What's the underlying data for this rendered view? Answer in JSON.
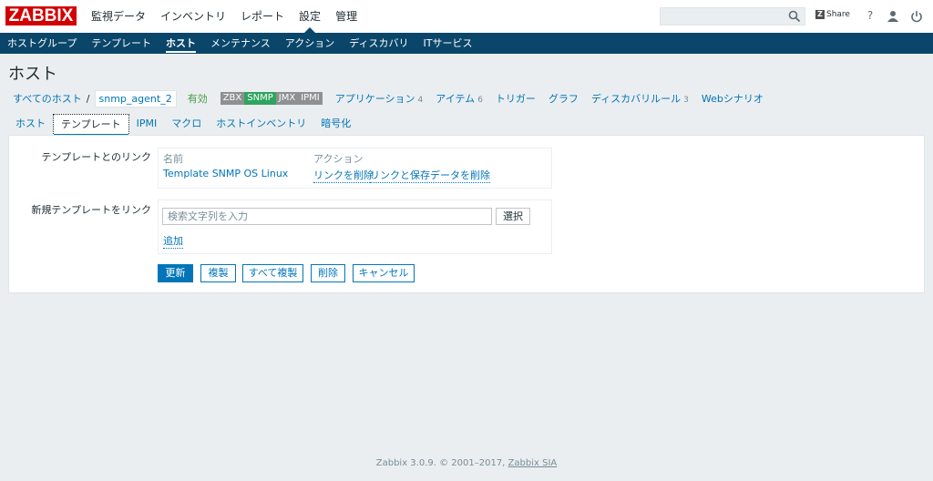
{
  "logo": "ZABBIX",
  "main_menu": [
    "監視データ",
    "インベントリ",
    "レポート",
    "設定",
    "管理"
  ],
  "header": {
    "share": "Share",
    "help": "?"
  },
  "sub_menu": [
    "ホストグループ",
    "テンプレート",
    "ホスト",
    "メンテナンス",
    "アクション",
    "ディスカバリ",
    "ITサービス"
  ],
  "page_title": "ホスト",
  "breadcrumb": {
    "all_hosts": "すべてのホスト",
    "separator": "/",
    "host": "snmp_agent_2",
    "status": "有効",
    "tags": [
      "ZBX",
      "SNMP",
      "JMX",
      "IPMI"
    ],
    "links": [
      {
        "label": "アプリケーション",
        "count": "4"
      },
      {
        "label": "アイテム",
        "count": "6"
      },
      {
        "label": "トリガー",
        "count": ""
      },
      {
        "label": "グラフ",
        "count": ""
      },
      {
        "label": "ディスカバリルール",
        "count": "3"
      },
      {
        "label": "Webシナリオ",
        "count": ""
      }
    ]
  },
  "tabs": [
    "ホスト",
    "テンプレート",
    "IPMI",
    "マクロ",
    "ホストインベントリ",
    "暗号化"
  ],
  "form": {
    "linked_label": "テンプレートとのリンク",
    "col_name": "名前",
    "col_action": "アクション",
    "template_name": "Template SNMP OS Linux",
    "unlink": "リンクを削除",
    "unlink_clear": "リンクと保存データを削除",
    "new_label": "新規テンプレートをリンク",
    "search_placeholder": "検索文字列を入力",
    "select_btn": "選択",
    "add_link": "追加"
  },
  "buttons": [
    "更新",
    "複製",
    "すべて複製",
    "削除",
    "キャンセル"
  ],
  "footer": {
    "text": "Zabbix 3.0.9. © 2001–2017, ",
    "link": "Zabbix SIA"
  },
  "colors": {
    "brand": "#d40000",
    "nav": "#0a466a",
    "link": "#0275b8",
    "enabled": "#429e47",
    "snmp_green": "#2ea55e"
  }
}
